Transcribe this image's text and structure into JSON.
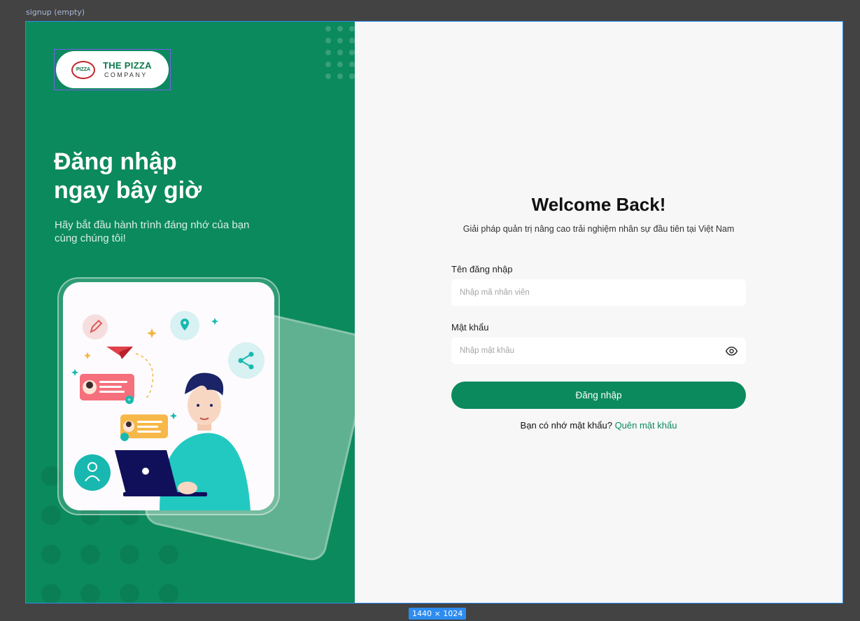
{
  "canvas": {
    "frame_label": "signup (empty)",
    "size_badge": "1440 × 1024"
  },
  "brand": {
    "logo_line1": "THE PIZZA",
    "logo_line2": "COMPANY",
    "badge_text": "PIZZA",
    "primary_color": "#0b8a5d"
  },
  "hero": {
    "title": "Đăng nhập\nngay bây giờ",
    "subtitle": "Hãy bắt đầu hành trình đáng nhớ của bạn\ncùng chúng tôi!"
  },
  "form": {
    "heading": "Welcome Back!",
    "tagline": "Giải pháp quản trị nâng cao trải nghiệm nhân sự đầu tiên tại Việt Nam",
    "username_label": "Tên đăng nhập",
    "username_placeholder": "Nhập mã nhân viên",
    "username_value": "",
    "password_label": "Mật khẩu",
    "password_placeholder": "Nhập mật khẩu",
    "password_value": "",
    "password_toggle_icon": "eye-icon",
    "submit_label": "Đăng nhập",
    "forgot_prompt": "Bạn có nhớ mật khẩu?",
    "forgot_link": "Quên mật khẩu"
  }
}
